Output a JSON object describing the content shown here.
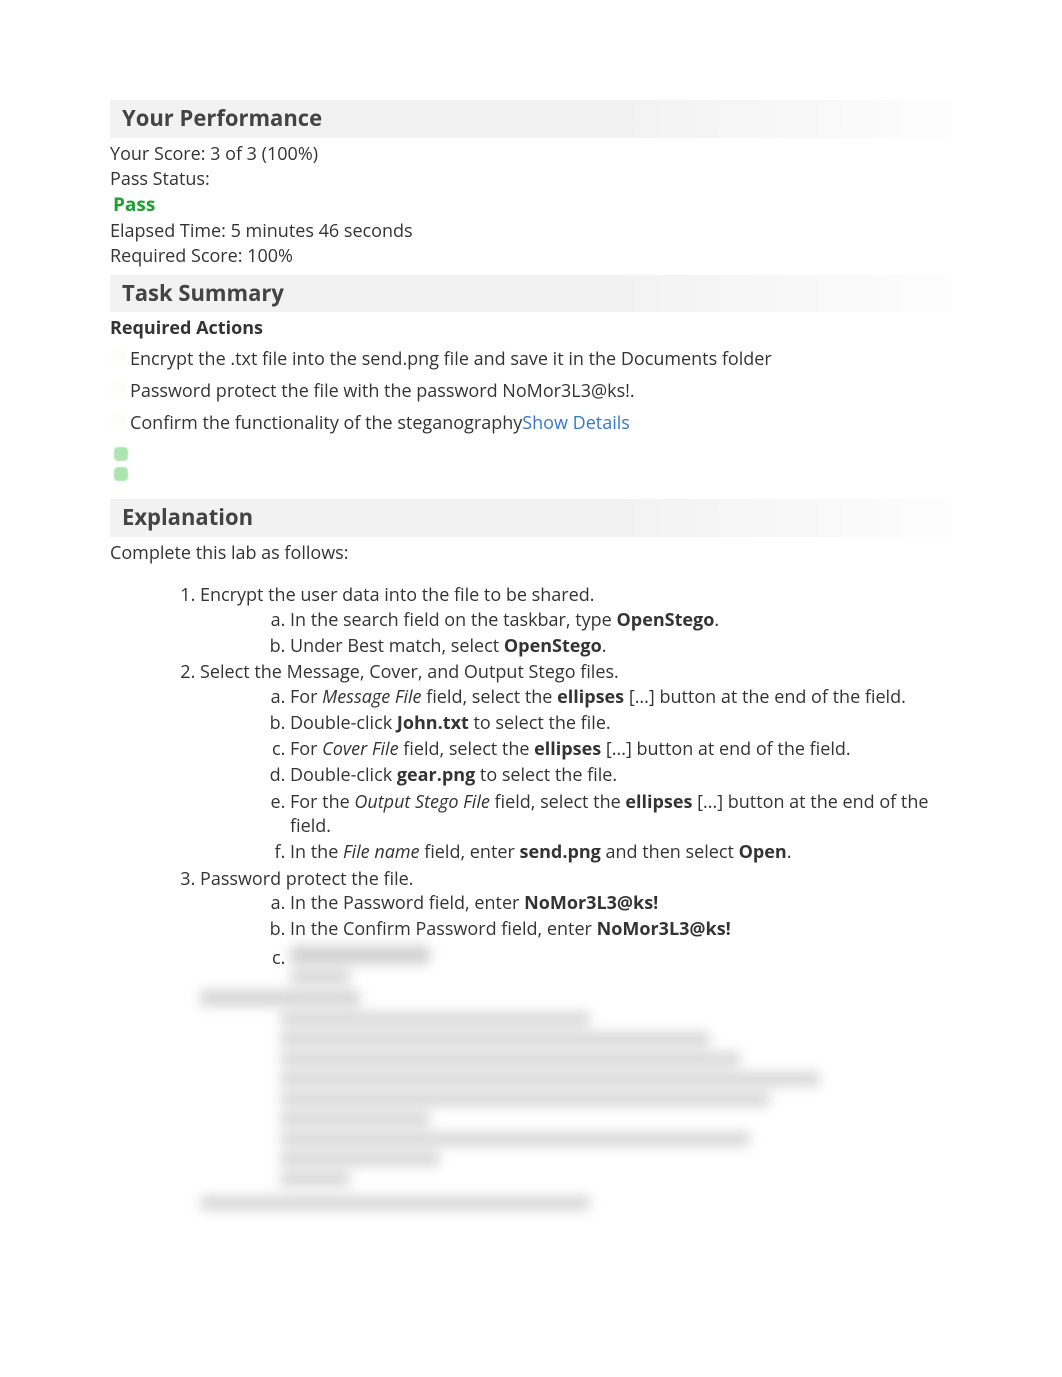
{
  "performance": {
    "header": "Your Performance",
    "score_line": "Your Score: 3 of 3 (100%)",
    "pass_status_label": "Pass Status:",
    "pass_status_value": "Pass",
    "elapsed_time": "Elapsed Time: 5 minutes 46 seconds",
    "required_score": "Required Score: 100%"
  },
  "task_summary": {
    "header": "Task Summary",
    "required_actions_label": "Required Actions",
    "actions": [
      "Encrypt the .txt file into the send.png file and save it in the Documents folder",
      "Password protect the file with the password NoMor3L3@ks!.",
      "Confirm the functionality of the steganography"
    ],
    "show_details": "Show Details"
  },
  "explanation": {
    "header": "Explanation",
    "intro": "Complete this lab as follows:",
    "step1": {
      "text": "Encrypt the user data into the file to be shared.",
      "a_pre": "In the search field on the taskbar, type ",
      "a_bold": "OpenStego",
      "a_post": ".",
      "b_pre": "Under Best match, select ",
      "b_bold": "OpenStego",
      "b_post": "."
    },
    "step2": {
      "text": "Select the Message, Cover, and Output Stego files.",
      "a_pre": "For ",
      "a_ital": "Message File",
      "a_mid": " field, select the ",
      "a_bold": "ellipses",
      "a_post": " [...] button at the end of the field.",
      "b_pre": "Double-click ",
      "b_bold": "John.txt",
      "b_post": " to select the file.",
      "c_pre": "For ",
      "c_ital": "Cover File",
      "c_mid": " field, select the ",
      "c_bold": "ellipses",
      "c_post": " [...] button at end of the field.",
      "d_pre": "Double-click ",
      "d_bold": "gear.png",
      "d_post": " to select the file.",
      "e_pre": "For the ",
      "e_ital": "Output Stego File",
      "e_mid": " field, select the ",
      "e_bold": "ellipses",
      "e_post": " [...] button at the end of the field.",
      "f_pre": "In the ",
      "f_ital": "File name",
      "f_mid": " field, enter ",
      "f_bold": "send.png",
      "f_mid2": " and then select ",
      "f_bold2": "Open",
      "f_post": "."
    },
    "step3": {
      "text": "Password protect the file.",
      "a_pre": "In the Password field, enter ",
      "a_bold": "NoMor3L3@ks!",
      "b_pre": "In the Confirm Password field, enter ",
      "b_bold": "NoMor3L3@ks!",
      "c_text": ""
    }
  }
}
